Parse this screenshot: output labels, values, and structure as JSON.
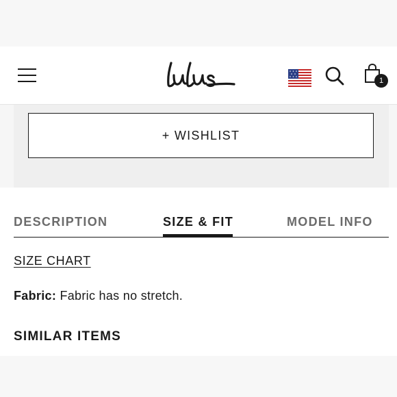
{
  "header": {
    "logo_text": "Lulus",
    "cart_count": "1",
    "icons": {
      "menu": "hamburger-menu-icon",
      "flag": "us-flag-icon",
      "search": "search-icon",
      "cart": "shopping-bag-icon"
    }
  },
  "product_actions": {
    "wishlist_label": "+ WISHLIST"
  },
  "tabs": [
    {
      "label": "DESCRIPTION",
      "active": false
    },
    {
      "label": "SIZE & FIT",
      "active": true
    },
    {
      "label": "MODEL INFO",
      "active": false
    }
  ],
  "size_fit": {
    "size_chart_link": "SIZE CHART",
    "fabric_label": "Fabric:",
    "fabric_value": "Fabric has no stretch."
  },
  "similar_items": {
    "heading": "SIMILAR ITEMS"
  },
  "colors": {
    "text": "#1a1a1a",
    "muted_tab": "#6b6b6b",
    "panel_bg": "#efefef",
    "page_bg": "#f6f6f6"
  }
}
